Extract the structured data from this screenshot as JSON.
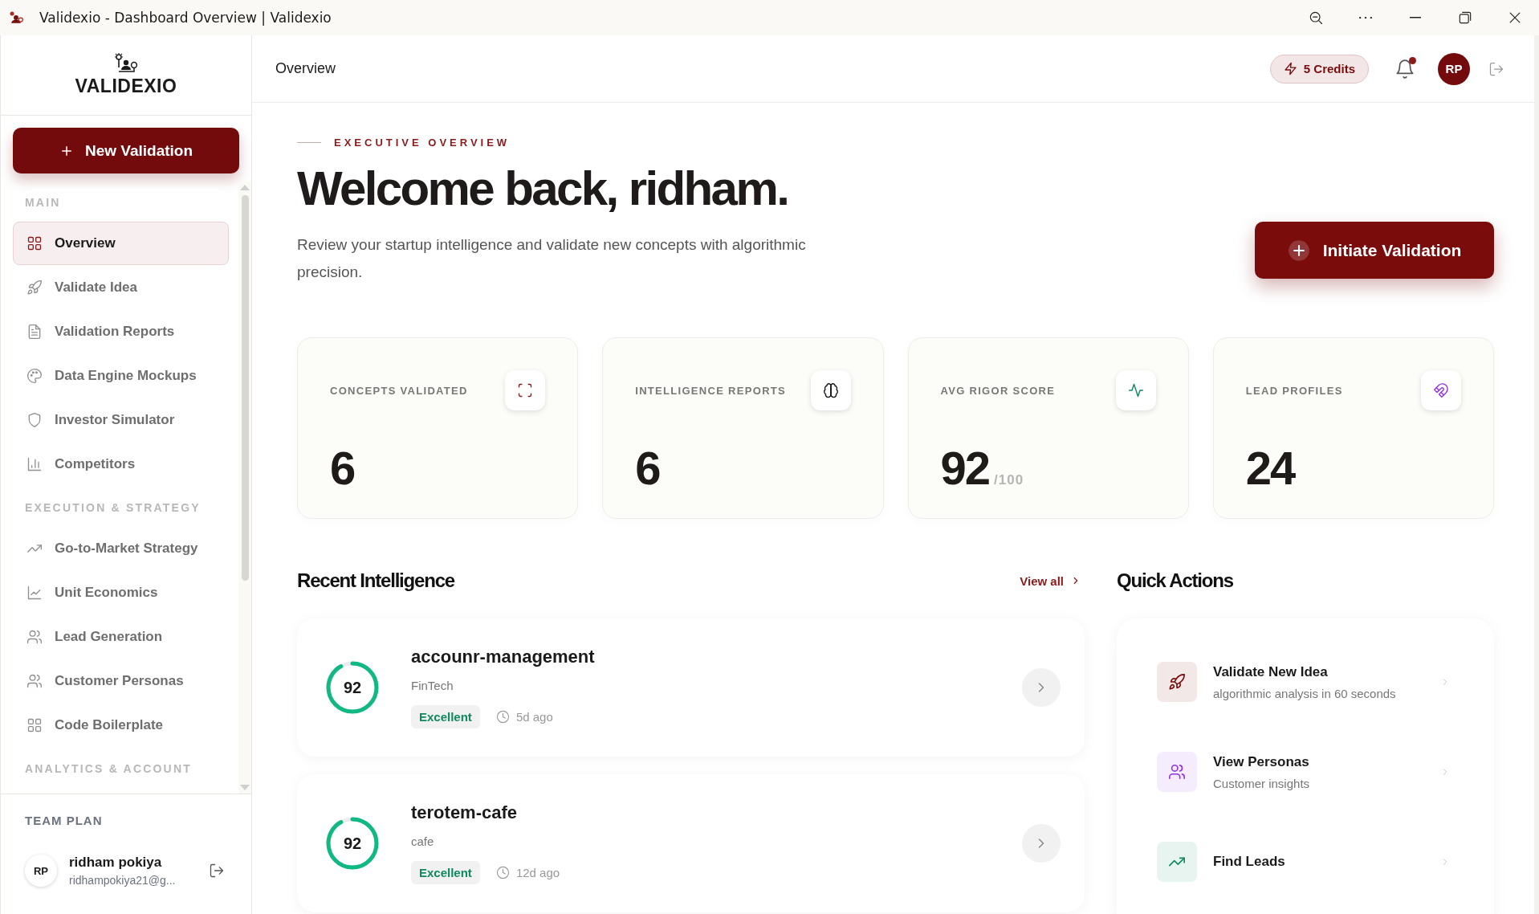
{
  "window": {
    "title": "Validexio - Dashboard Overview | Validexio"
  },
  "sidebar": {
    "logo": "VALIDEXIO",
    "new_button": "New Validation",
    "sections": [
      {
        "heading": "MAIN",
        "items": [
          {
            "label": "Overview",
            "selected": true
          },
          {
            "label": "Validate Idea",
            "selected": false
          },
          {
            "label": "Validation Reports",
            "selected": false
          },
          {
            "label": "Data Engine Mockups",
            "selected": false
          },
          {
            "label": "Investor Simulator",
            "selected": false
          },
          {
            "label": "Competitors",
            "selected": false
          }
        ]
      },
      {
        "heading": "EXECUTION & STRATEGY",
        "items": [
          {
            "label": "Go-to-Market Strategy",
            "selected": false
          },
          {
            "label": "Unit Economics",
            "selected": false
          },
          {
            "label": "Lead Generation",
            "selected": false
          },
          {
            "label": "Customer Personas",
            "selected": false
          },
          {
            "label": "Code Boilerplate",
            "selected": false
          }
        ]
      },
      {
        "heading": "ANALYTICS & ACCOUNT"
      }
    ],
    "footer": {
      "plan": "TEAM PLAN",
      "avatar": "RP",
      "name": "ridham pokiya",
      "email": "ridhampokiya21@g..."
    }
  },
  "header": {
    "title": "Overview",
    "credits": "5 Credits",
    "unread_notifications": true,
    "avatar": "RP"
  },
  "hero": {
    "eyebrow": "EXECUTIVE OVERVIEW",
    "heading": "Welcome back, ridham.",
    "description": "Review your startup intelligence and validate new concepts with algorithmic precision.",
    "button": "Initiate Validation"
  },
  "stats": [
    {
      "label": "CONCEPTS VALIDATED",
      "value": "6"
    },
    {
      "label": "INTELLIGENCE REPORTS",
      "value": "6"
    },
    {
      "label": "AVG RIGOR SCORE",
      "value": "92",
      "suffix": "/100"
    },
    {
      "label": "LEAD PROFILES",
      "value": "24"
    }
  ],
  "recent": {
    "heading": "Recent Intelligence",
    "link": "View all",
    "items": [
      {
        "score": "92",
        "title": "accounr-management",
        "category": "FinTech",
        "badge": "Excellent",
        "time": "5d ago"
      },
      {
        "score": "92",
        "title": "terotem-cafe",
        "category": "cafe",
        "badge": "Excellent",
        "time": "12d ago"
      }
    ]
  },
  "quick_actions": {
    "heading": "Quick Actions",
    "items": [
      {
        "title": "Validate New Idea",
        "subtitle": "algorithmic analysis in 60 seconds"
      },
      {
        "title": "View Personas",
        "subtitle": "Customer insights"
      },
      {
        "title": "Find Leads"
      }
    ]
  }
}
